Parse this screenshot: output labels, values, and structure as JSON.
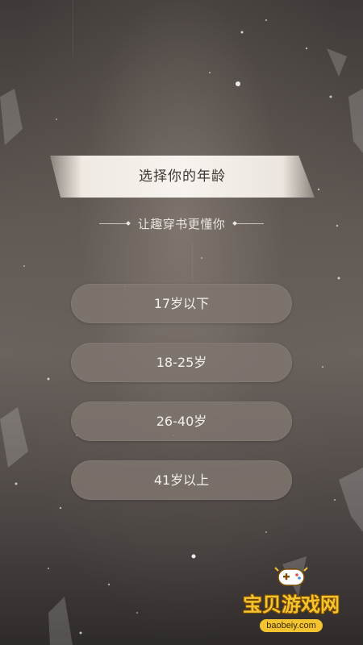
{
  "page": {
    "title": "选择你的年龄",
    "subtitle": "让趣穿书更懂你"
  },
  "age_options": [
    {
      "label": "17岁以下"
    },
    {
      "label": "18-25岁"
    },
    {
      "label": "26-40岁"
    },
    {
      "label": "41岁以上"
    }
  ],
  "watermark": {
    "name": "宝贝游戏网",
    "url": "baobeiy.com",
    "icon": "gamepad-icon"
  },
  "colors": {
    "background": "#5f5752",
    "option_fill": "#807670",
    "banner_fill": "#f4efe9",
    "watermark_yellow": "#f4c430"
  }
}
